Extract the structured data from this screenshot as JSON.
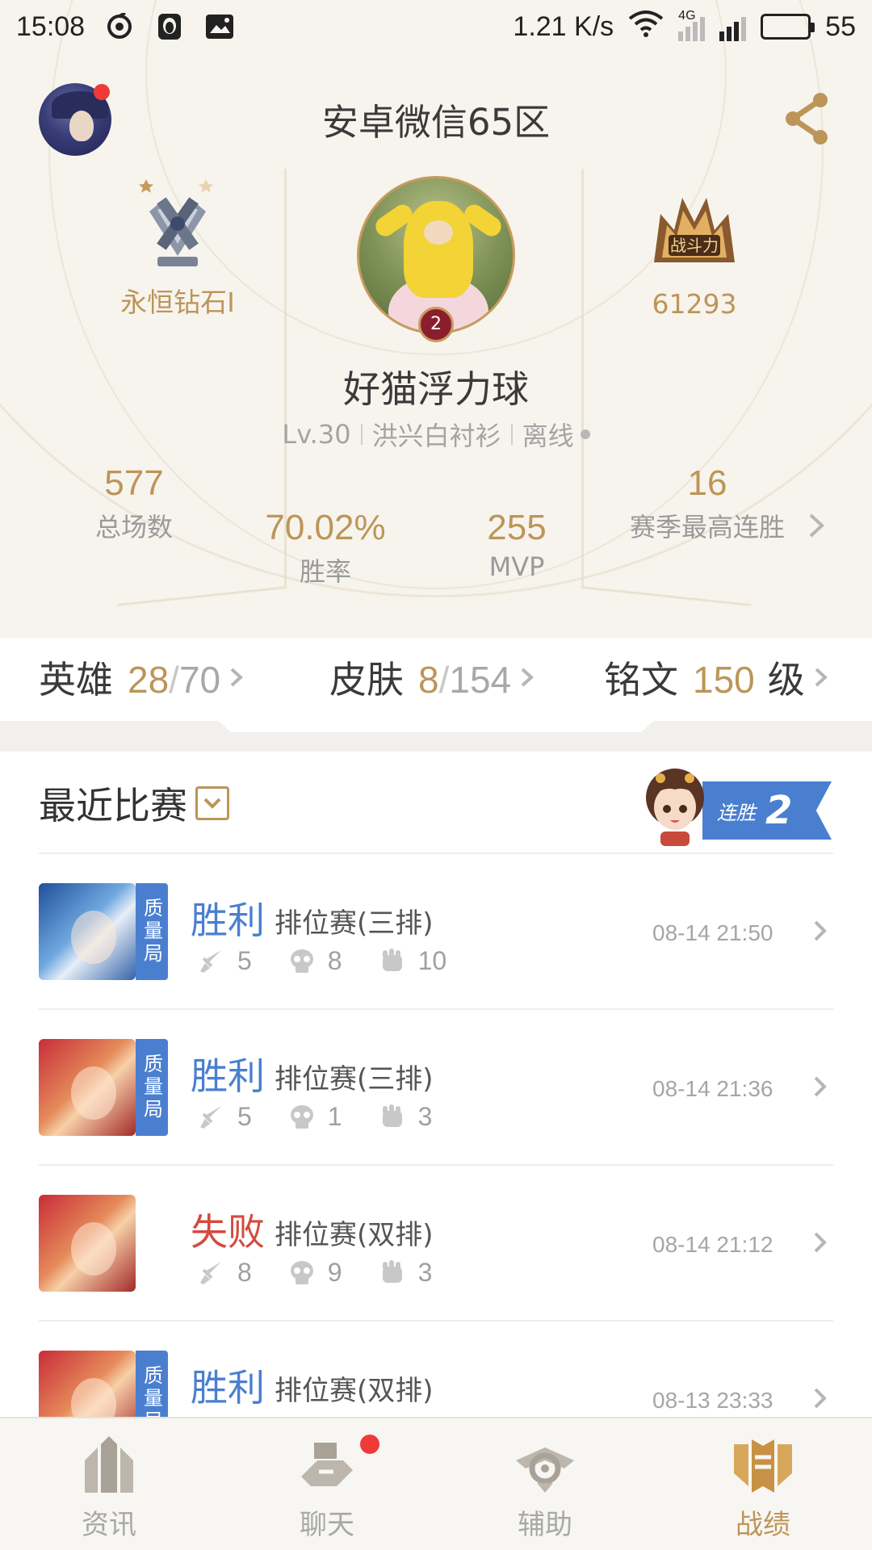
{
  "status_bar": {
    "time": "15:08",
    "net_speed": "1.21 K/s",
    "network": "4G",
    "battery": "55"
  },
  "header": {
    "server_title": "安卓微信65区"
  },
  "profile": {
    "rank_name": "永恒钻石I",
    "combat_power": "61293",
    "level_badge": "2",
    "nickname": "好猫浮力球",
    "level": "Lv.30",
    "title": "洪兴白衬衫",
    "online_status": "离线"
  },
  "stats": {
    "total_games_value": "577",
    "total_games_label": "总场数",
    "win_rate_value": "70.02%",
    "win_rate_label": "胜率",
    "mvp_value": "255",
    "mvp_label": "MVP",
    "best_streak_value": "16",
    "best_streak_label": "赛季最高连胜"
  },
  "summary": {
    "heroes_label": "英雄",
    "heroes_owned": "28",
    "heroes_total": "70",
    "skins_label": "皮肤",
    "skins_owned": "8",
    "skins_total": "154",
    "inscription_label": "铭文",
    "inscription_level": "150",
    "inscription_unit": "级"
  },
  "recent": {
    "title": "最近比赛",
    "streak_label": "连胜",
    "streak_count": "2",
    "quality_tag": "质量局",
    "matches": [
      {
        "result": "胜利",
        "mode": "排位赛(三排)",
        "kills": "5",
        "deaths": "8",
        "assists": "10",
        "time": "08-14 21:50",
        "hero": "blue",
        "quality": true,
        "win": true
      },
      {
        "result": "胜利",
        "mode": "排位赛(三排)",
        "kills": "5",
        "deaths": "1",
        "assists": "3",
        "time": "08-14 21:36",
        "hero": "red",
        "quality": true,
        "win": true
      },
      {
        "result": "失败",
        "mode": "排位赛(双排)",
        "kills": "8",
        "deaths": "9",
        "assists": "3",
        "time": "08-14 21:12",
        "hero": "red",
        "quality": false,
        "win": false
      },
      {
        "result": "胜利",
        "mode": "排位赛(双排)",
        "kills": "",
        "deaths": "",
        "assists": "",
        "time": "08-13 23:33",
        "hero": "red",
        "quality": true,
        "win": true
      }
    ]
  },
  "nav": {
    "items": [
      {
        "label": "资讯",
        "icon": "news-icon"
      },
      {
        "label": "聊天",
        "icon": "chat-icon"
      },
      {
        "label": "辅助",
        "icon": "assist-icon"
      },
      {
        "label": "战绩",
        "icon": "record-icon"
      }
    ],
    "active_index": 3
  },
  "colors": {
    "gold": "#bd9558",
    "win_blue": "#4a7fd0",
    "lose_red": "#d44a3e",
    "notify_red": "#f03a3a"
  }
}
